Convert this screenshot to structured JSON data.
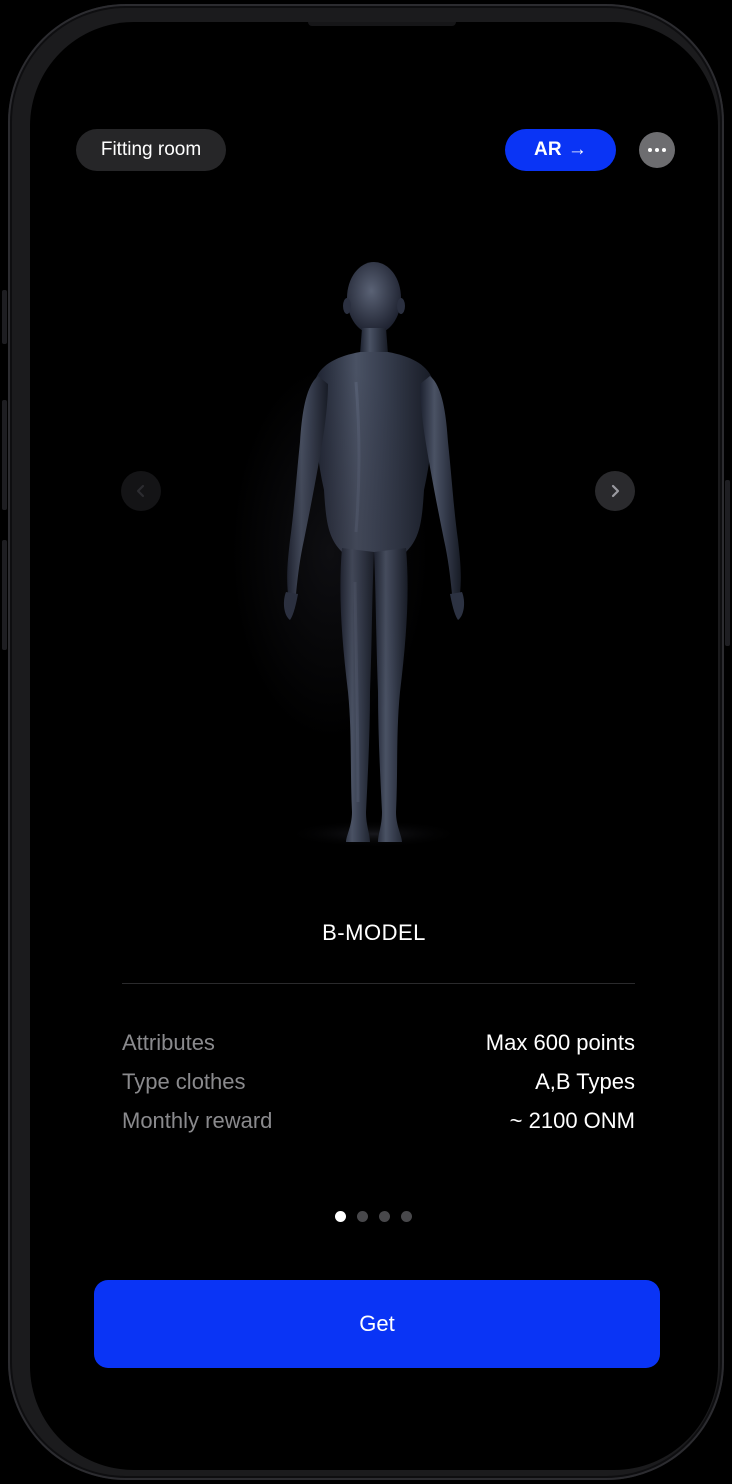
{
  "header": {
    "fitting_room_label": "Fitting room",
    "ar_label": "AR",
    "ar_arrow": "→",
    "more_icon": "more-horizontal-icon"
  },
  "carousel": {
    "prev_icon": "chevron-left-icon",
    "next_icon": "chevron-right-icon",
    "model_name": "B-MODEL",
    "page_count": 4,
    "active_page": 1
  },
  "attributes": [
    {
      "label": "Attributes",
      "value": "Max 600 points"
    },
    {
      "label": "Type clothes",
      "value": "A,B Types"
    },
    {
      "label": "Monthly reward",
      "value": "~ 2100 ONM"
    }
  ],
  "actions": {
    "get_label": "Get"
  },
  "colors": {
    "accent": "#0a34f5",
    "background": "#000000",
    "muted_text": "#8a8a8d"
  }
}
